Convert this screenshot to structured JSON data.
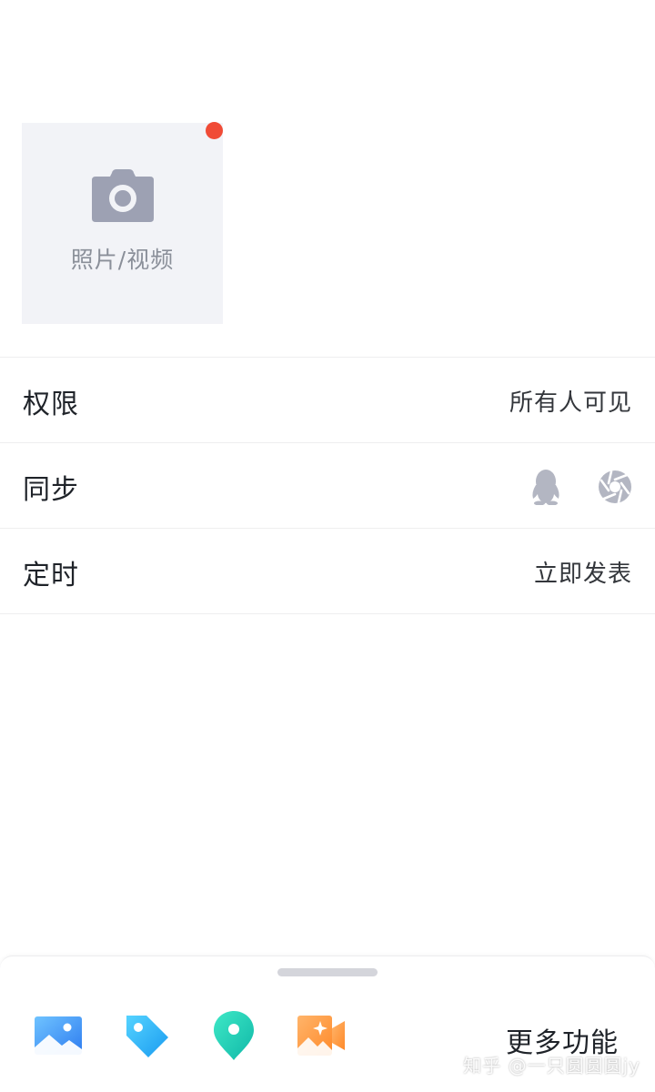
{
  "media": {
    "label": "照片/视频",
    "icon": "camera-icon",
    "has_notification": true
  },
  "rows": [
    {
      "title": "权限",
      "value": "所有人可见"
    },
    {
      "title": "同步",
      "icons": [
        "qq-icon",
        "aperture-icon"
      ]
    },
    {
      "title": "定时",
      "value": "立即发表"
    }
  ],
  "toolbar": {
    "tools": [
      "image-icon",
      "tag-icon",
      "location-icon",
      "video-icon"
    ],
    "more_label": "更多功能"
  },
  "watermark": "知乎 @一只圆圆圆jy",
  "colors": {
    "notification": "#f04b36",
    "image": "#3d9af5",
    "tag": "#1fb4f5",
    "location": "#18d1b8",
    "video": "#ff9a3d"
  }
}
